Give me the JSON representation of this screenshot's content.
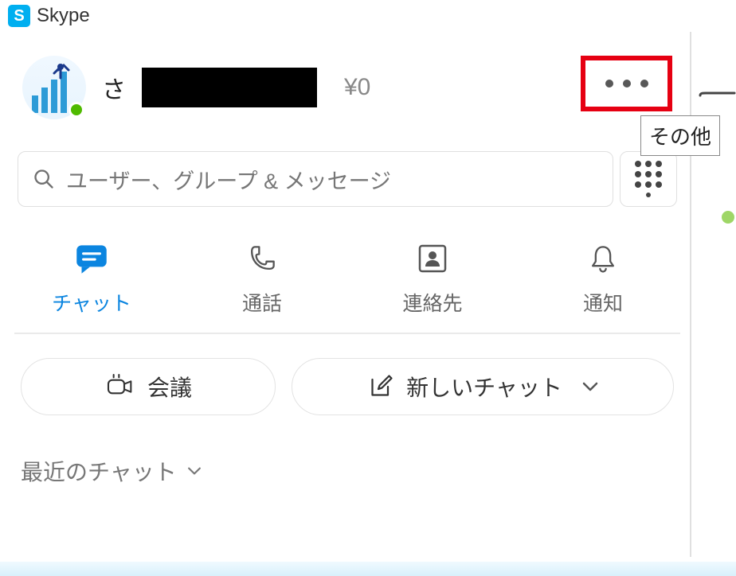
{
  "title": "Skype",
  "profile": {
    "name_prefix": "さ",
    "name_suffix": "",
    "credit": "¥0"
  },
  "more_tooltip": "その他",
  "search": {
    "placeholder": "ユーザー、グループ & メッセージ"
  },
  "tabs": {
    "chat": "チャット",
    "calls": "通話",
    "contacts": "連絡先",
    "notifications": "通知"
  },
  "actions": {
    "meet": "会議",
    "newchat": "新しいチャット"
  },
  "sections": {
    "recent_chats": "最近のチャット"
  }
}
